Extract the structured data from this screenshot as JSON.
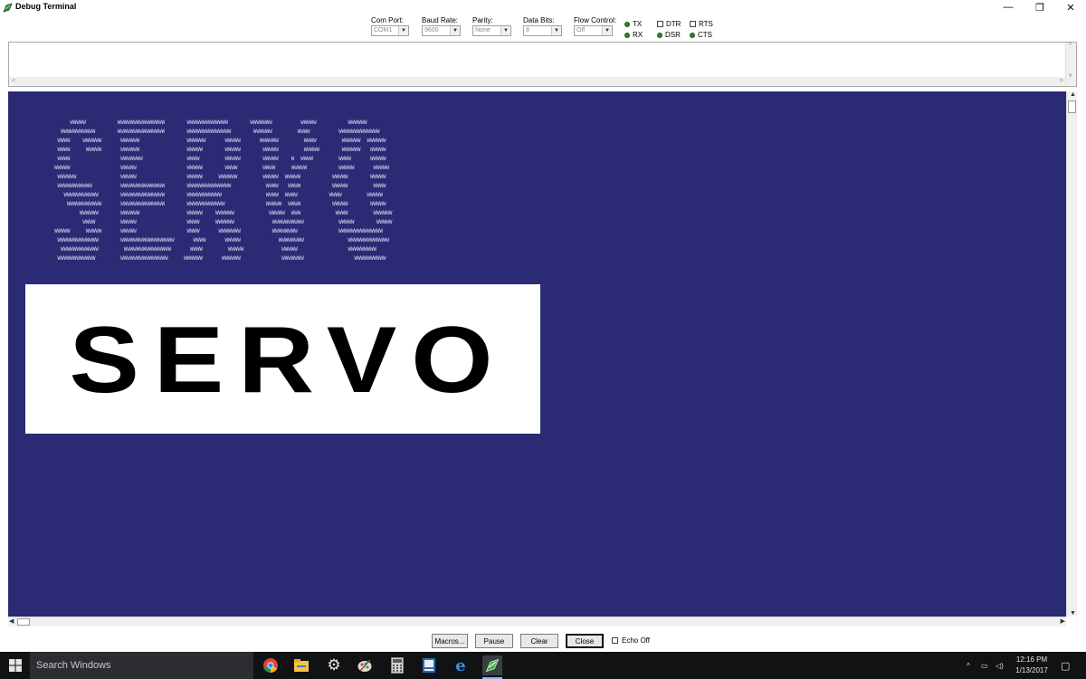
{
  "window": {
    "title": "Debug Terminal",
    "minimize_glyph": "—",
    "maximize_glyph": "❐",
    "close_glyph": "✕",
    "icon": "debug-terminal-icon"
  },
  "settings": {
    "com_port": {
      "label": "Com Port:",
      "value": "COM1"
    },
    "baud_rate": {
      "label": "Baud Rate:",
      "value": "9600"
    },
    "parity": {
      "label": "Parity:",
      "value": "None"
    },
    "data_bits": {
      "label": "Data Bits:",
      "value": "8"
    },
    "flow_control": {
      "label": "Flow Control:",
      "value": "Off"
    }
  },
  "indicators": {
    "tx": "TX",
    "rx": "RX",
    "dtr": "DTR",
    "dsr": "DSR",
    "rts": "RTS",
    "cts": "CTS",
    "led_color": "#1e8a3a"
  },
  "terminal": {
    "background": "#2b2a75",
    "ascii_art": "       WWWWW          WWWWWWWWWWWWWWW       WWWWWWWWWWWWW       WWWWWWW         WWWWW          WWWWWW\n    WWWWWWWWWWW       WWWWWWWWWWWWWWW       WWWWWWWWWWWWWW       WWWWWW        WWWW         WWWWWWWWWWWWW\n   WWWW    WWWWWW      WWWWWW               WWWWWW      WWWWW      WWWWWW        WWWW        WWWWWW  WWWWWW\n   WWWW     WWWWW      WWWWWW               WWWWW       WWWWW       WWWWW        WWWWW       WWWWWW   WWWWW\n   WWWW                WWWWWWW              WWWW        WWWWW       WWWWW    W  WWWW        WWWW      WWWWW\n  WWWWW                WWWWW                WWWWW       WWWW        WWWW     WWWWW          WWWWW      WWWWW\n   WWWWWW              WWWWW                WWWWW     WWWWWW        WWWWW  WWWWW          WWWWW       WWWWW\n   WWWWWWWWWWW         WWWWWWWWWWWWWW       WWWWWWWWWWWWWW           WWWW   WWWW          WWWWW        WWWW\n     WWWWWWWWWWW       WWWWWWWWWWWWWW       WWWWWWWWWWW              WWWW  WWWW          WWWW        WWWWW\n      WWWWWWWWWWW      WWWWWWWWWWWWWW       WWWWWWWWWWWW             WWWWW  WWWW          WWWWW       WWWWW\n          WWWWWW       WWWWWW               WWWWW    WWWWWW           WWWWW  WWW           WWWW        WWWWWW\n           WWWW        WWWWW                WWWW     WWWWWW            WWWWWWWWWW           WWWWW       WWWWW\n  WWWWW     WWWWW      WWWWW                WWWW      WWWWWWW          WWWWWWWW             WWWWWWWWWWWWWW\n   WWWWWWWWWWWWW       WWWWWWWWWWWWWWWWW      WWWW      WWWWW            WWWWWWWW              WWWWWWWWWWWWW\n    WWWWWWWWWWWW        WWWWWWWWWWWWWWW      WWWW        WWWWW            WWWWW                WWWWWWWWW\n   WWWWWWWWWWWW        WWWWWWWWWWWWWWW     WWWWWW      WWWWWW             WWWWWWW                WWWWWWWWWW",
    "banner_text": "SERVO"
  },
  "buttons": {
    "macros": "Macros...",
    "pause": "Pause",
    "clear": "Clear",
    "close": "Close",
    "echo_off": "Echo Off"
  },
  "taskbar": {
    "search_placeholder": "Search Windows",
    "time": "12:16 PM",
    "date": "1/13/2017",
    "up_glyph": "^",
    "network_glyph": "▭",
    "volume_glyph": "◁)",
    "notification_glyph": "▢",
    "pinned_icons": [
      "chrome-icon",
      "file-explorer-icon",
      "settings-icon",
      "paint-icon",
      "calculator-icon",
      "document-icon",
      "edge-icon",
      "debug-terminal-icon"
    ]
  }
}
